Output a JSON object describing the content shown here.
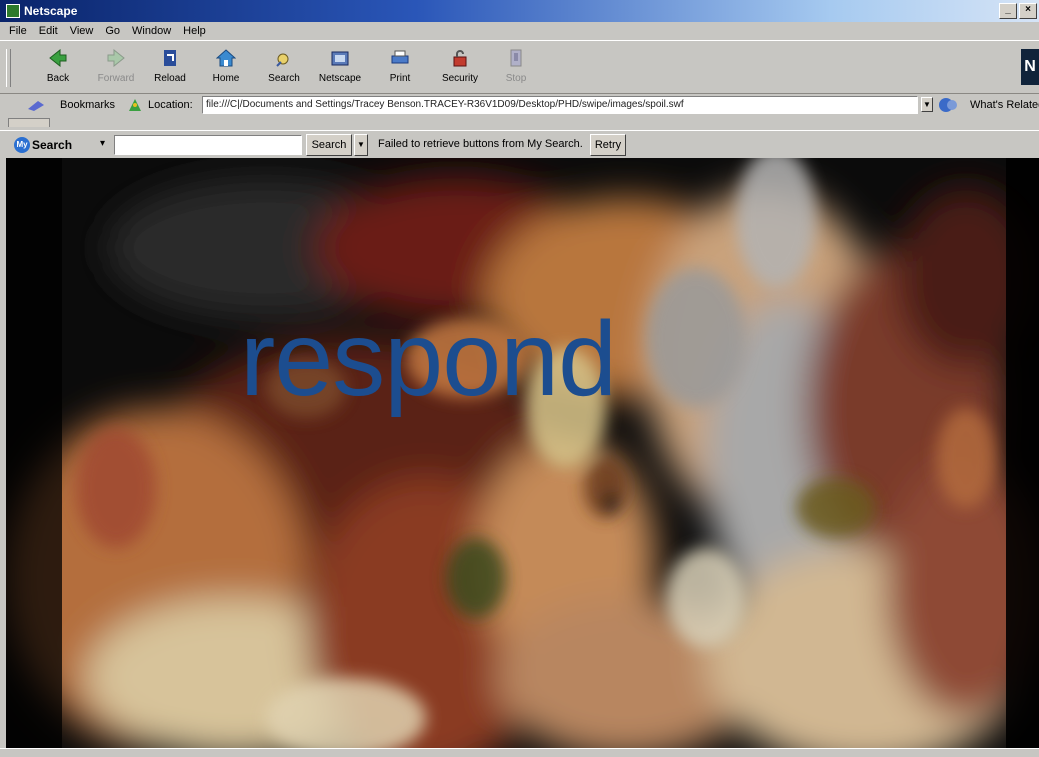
{
  "window": {
    "title": "Netscape",
    "buttons": [
      "_",
      "×"
    ]
  },
  "menu": [
    "File",
    "Edit",
    "View",
    "Go",
    "Window",
    "Help"
  ],
  "toolbar": {
    "back": "Back",
    "forward": "Forward",
    "reload": "Reload",
    "home": "Home",
    "search": "Search",
    "netscape": "Netscape",
    "print": "Print",
    "security": "Security",
    "stop": "Stop",
    "logo": "N"
  },
  "location": {
    "bookmarks_label": "Bookmarks",
    "location_label": "Location:",
    "url": "file:///C|/Documents and Settings/Tracey Benson.TRACEY-R36V1D09/Desktop/PHD/swipe/images/spoil.swf",
    "related_label": "What's Related"
  },
  "mysearch": {
    "label": "Search",
    "badge": "My",
    "search_button": "Search",
    "message": "Failed to retrieve buttons from My Search.",
    "retry_button": "Retry"
  },
  "content": {
    "word": "respond"
  },
  "colors": {
    "word": "#1c4d8f",
    "titlebar_start": "#0a246a",
    "chrome": "#c7c6c2"
  }
}
